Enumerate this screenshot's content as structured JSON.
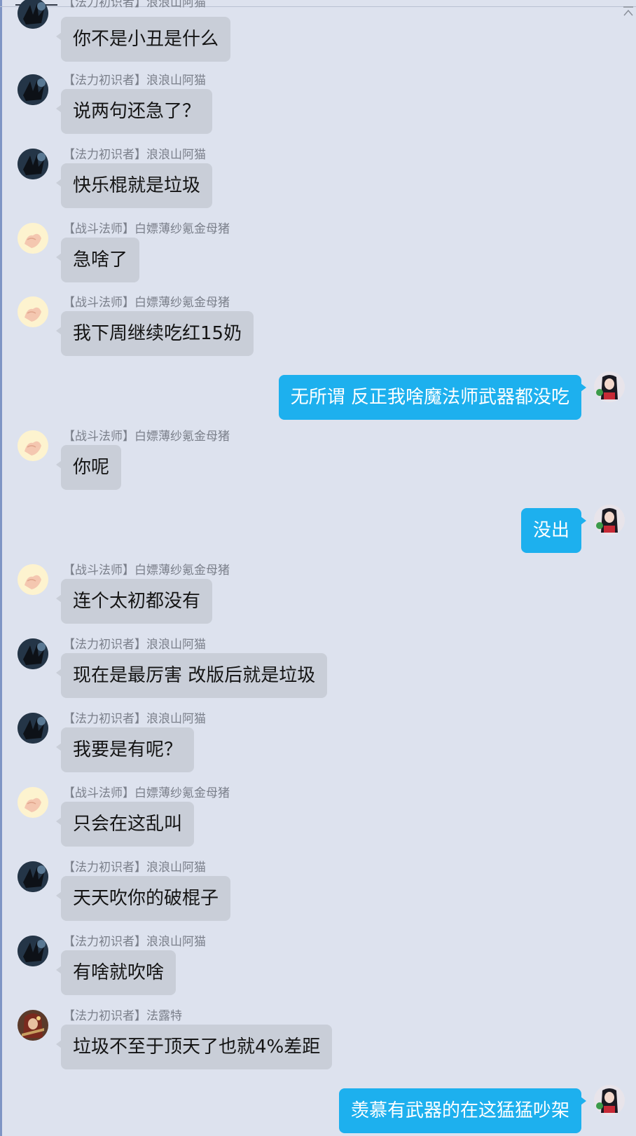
{
  "chat": {
    "messages": [
      {
        "side": "left",
        "avatar": "hand-dark-avatar",
        "sender": "【法力初识者】浪浪山阿猫",
        "text": "你不是小丑是什么"
      },
      {
        "side": "left",
        "avatar": "hand-dark-avatar",
        "sender": "【法力初识者】浪浪山阿猫",
        "text": "说两句还急了？"
      },
      {
        "side": "left",
        "avatar": "hand-dark-avatar",
        "sender": "【法力初识者】浪浪山阿猫",
        "text": "快乐棍就是垃圾"
      },
      {
        "side": "left",
        "avatar": "hand-light-avatar",
        "sender": "【战斗法师】白嫖薄纱氪金母猪",
        "text": "急啥了"
      },
      {
        "side": "left",
        "avatar": "hand-light-avatar",
        "sender": "【战斗法师】白嫖薄纱氪金母猪",
        "text": "我下周继续吃红15奶"
      },
      {
        "side": "right",
        "avatar": "anime-girl-avatar",
        "sender": "",
        "text": "无所谓 反正我啥魔法师武器都没吃"
      },
      {
        "side": "left",
        "avatar": "hand-light-avatar",
        "sender": "【战斗法师】白嫖薄纱氪金母猪",
        "text": "你呢"
      },
      {
        "side": "right",
        "avatar": "anime-girl-avatar",
        "sender": "",
        "text": "没出"
      },
      {
        "side": "left",
        "avatar": "hand-light-avatar",
        "sender": "【战斗法师】白嫖薄纱氪金母猪",
        "text": "连个太初都没有"
      },
      {
        "side": "left",
        "avatar": "hand-dark-avatar",
        "sender": "【法力初识者】浪浪山阿猫",
        "text": "现在是最厉害 改版后就是垃圾"
      },
      {
        "side": "left",
        "avatar": "hand-dark-avatar",
        "sender": "【法力初识者】浪浪山阿猫",
        "text": "我要是有呢？"
      },
      {
        "side": "left",
        "avatar": "hand-light-avatar",
        "sender": "【战斗法师】白嫖薄纱氪金母猪",
        "text": "只会在这乱叫"
      },
      {
        "side": "left",
        "avatar": "hand-dark-avatar",
        "sender": "【法力初识者】浪浪山阿猫",
        "text": "天天吹你的破棍子"
      },
      {
        "side": "left",
        "avatar": "hand-dark-avatar",
        "sender": "【法力初识者】浪浪山阿猫",
        "text": "有啥就吹啥"
      },
      {
        "side": "left",
        "avatar": "warrior-avatar",
        "sender": "【法力初识者】法露特",
        "text": "垃圾不至于顶天了也就4%差距"
      },
      {
        "side": "right",
        "avatar": "anime-girl-avatar",
        "sender": "",
        "text": "羡慕有武器的在这猛猛吵架"
      }
    ]
  },
  "colors": {
    "background": "#dde2ee",
    "incoming_bubble": "#c9ced8",
    "outgoing_bubble": "#1db0ee",
    "sender_text": "#7a7f8a"
  }
}
